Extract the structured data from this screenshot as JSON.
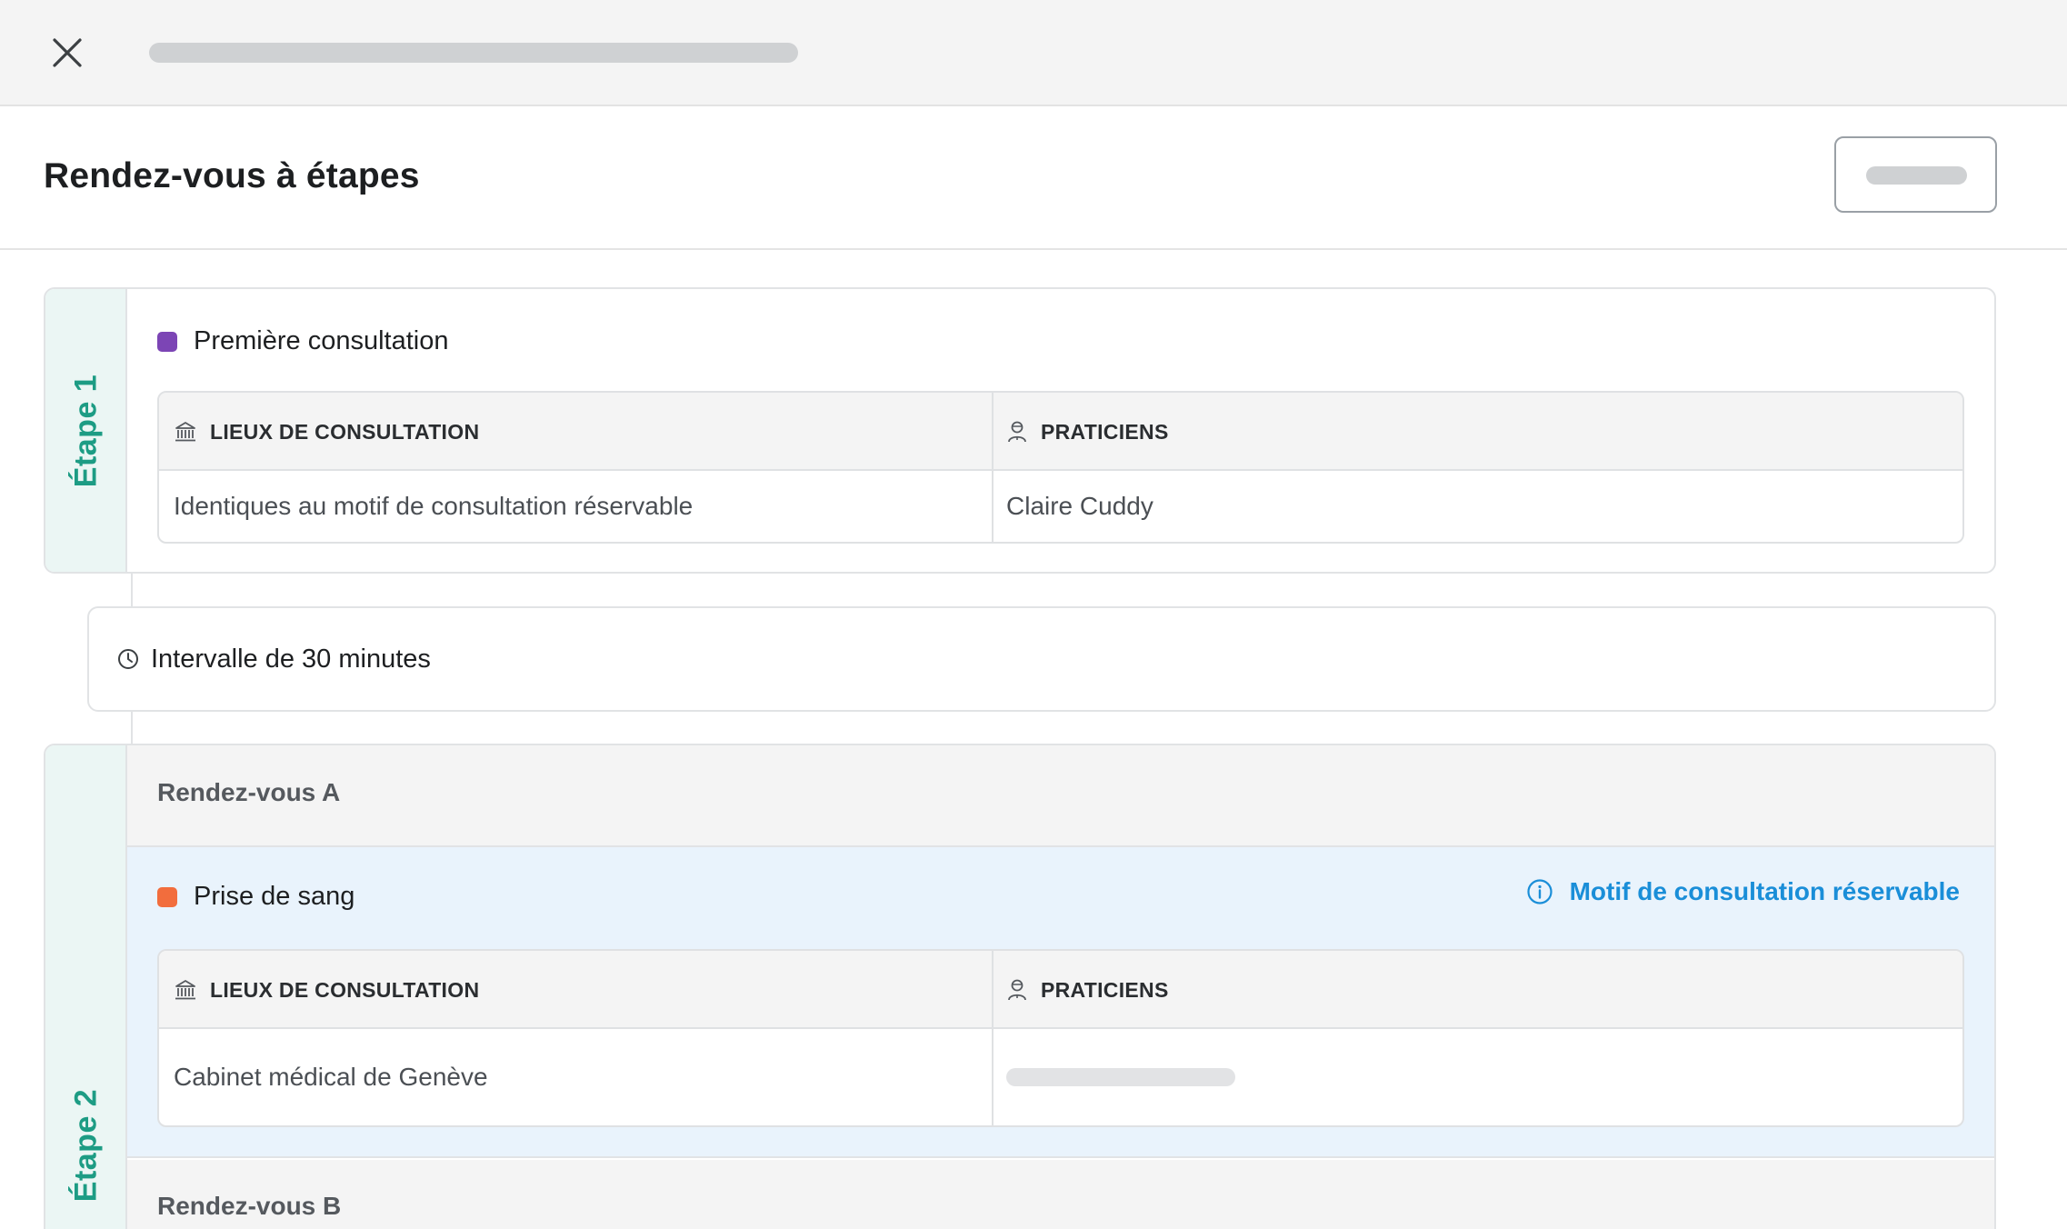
{
  "header": {
    "title": "Rendez-vous à étapes"
  },
  "icons": {
    "close": "close-icon",
    "building": "building-icon",
    "practitioner": "practitioner-icon",
    "clock": "clock-icon",
    "info": "info-icon"
  },
  "colors": {
    "accent_teal": "#1d9c84",
    "link_blue": "#1a8ed8",
    "motif_purple": "#7c45b5",
    "motif_orange": "#f26d3d"
  },
  "step1": {
    "label": "Étape 1",
    "motif": "Première consultation",
    "table": {
      "col1_header": "LIEUX DE CONSULTATION",
      "col2_header": "PRATICIENS",
      "col1_value": "Identiques au motif de consultation réservable",
      "col2_value": "Claire Cuddy"
    }
  },
  "interval": {
    "text": "Intervalle de 30 minutes"
  },
  "step2": {
    "label": "Étape 2",
    "appointment_a": {
      "title": "Rendez-vous A",
      "motif": "Prise de sang",
      "info_link": "Motif de consultation réservable",
      "table": {
        "col1_header": "LIEUX DE CONSULTATION",
        "col2_header": "PRATICIENS",
        "col1_value": "Cabinet médical de Genève"
      }
    },
    "appointment_b": {
      "title": "Rendez-vous B"
    }
  }
}
